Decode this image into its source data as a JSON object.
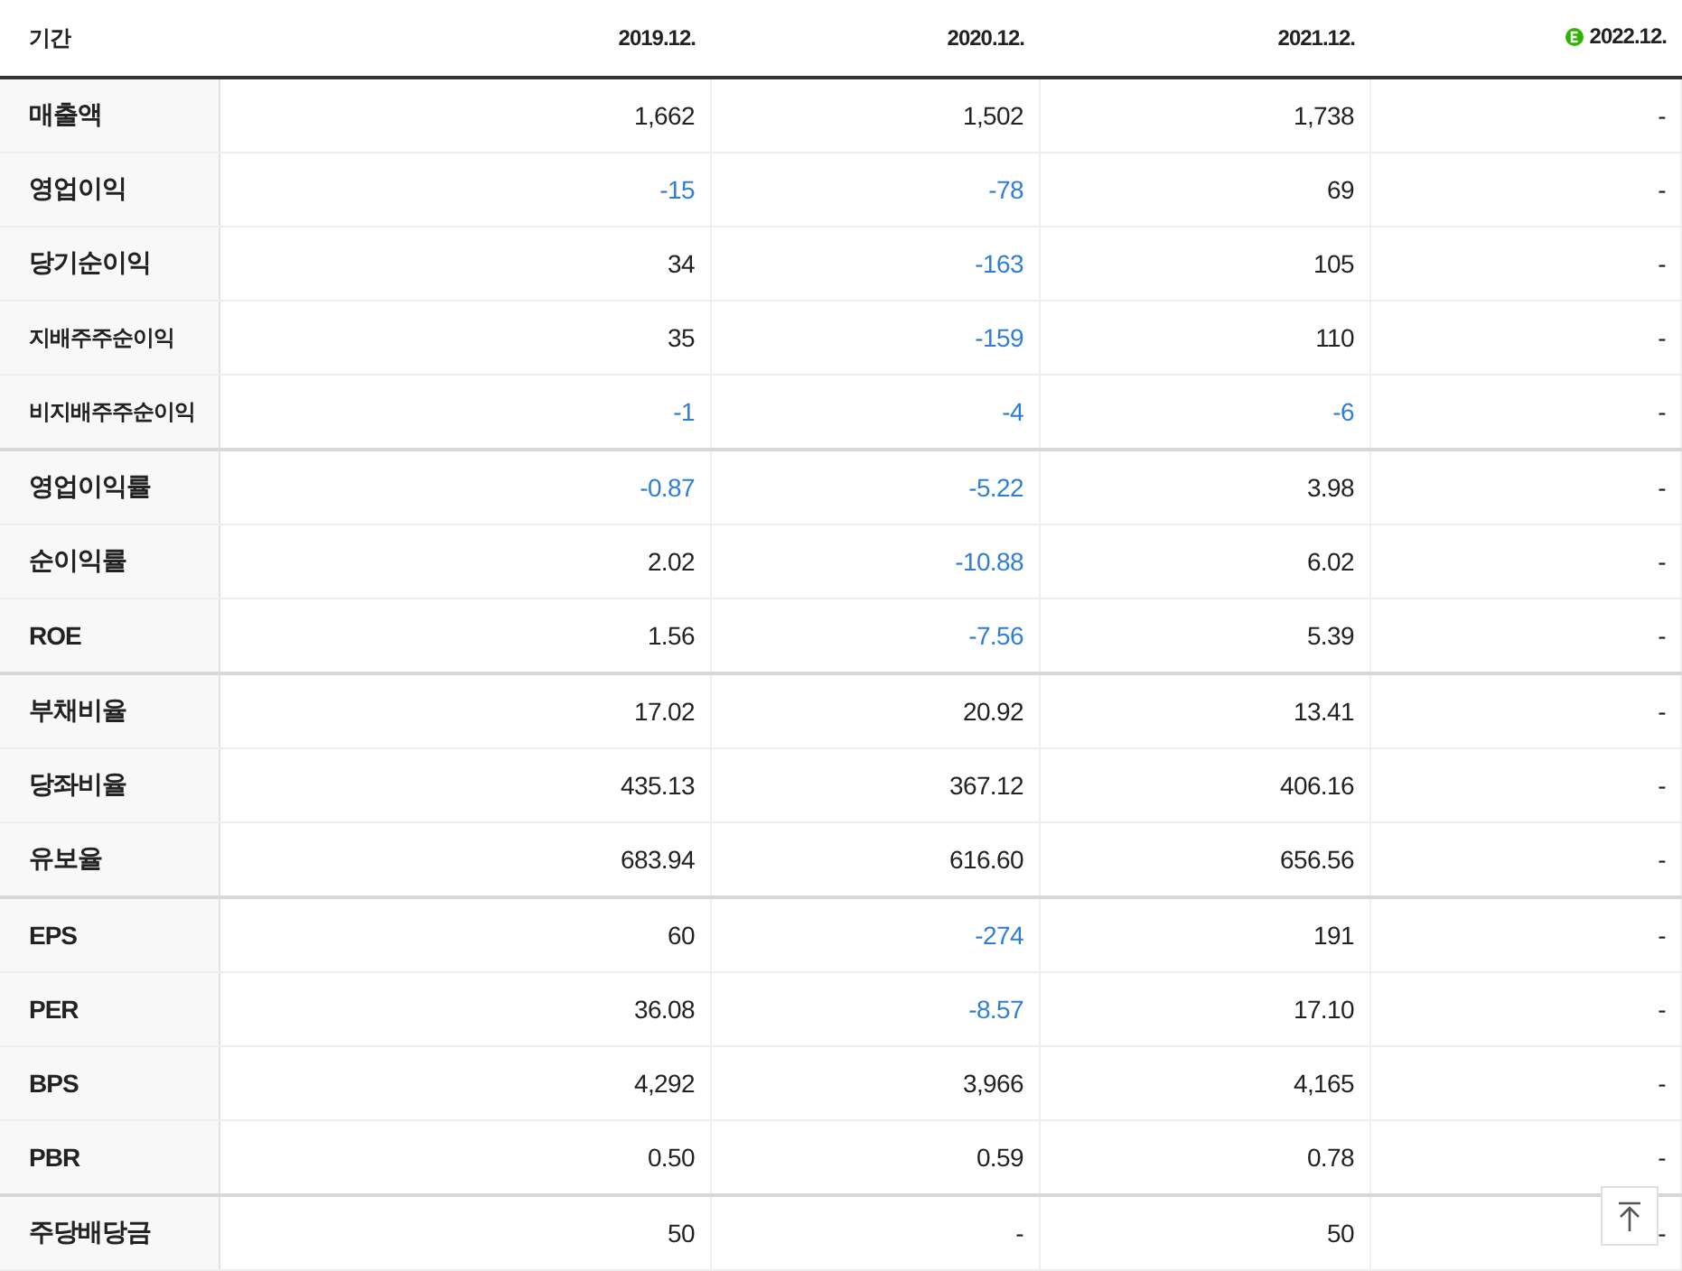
{
  "table": {
    "corner_label": "기간",
    "columns": [
      {
        "label": "2019.12.",
        "estimate": false
      },
      {
        "label": "2020.12.",
        "estimate": false
      },
      {
        "label": "2021.12.",
        "estimate": false
      },
      {
        "label": "2022.12.",
        "estimate": true
      }
    ],
    "rows": [
      {
        "label": "매출액",
        "compact": false,
        "group_start": false,
        "cells": [
          {
            "text": "1,662",
            "negative": false
          },
          {
            "text": "1,502",
            "negative": false
          },
          {
            "text": "1,738",
            "negative": false
          },
          {
            "text": "-",
            "negative": false
          }
        ]
      },
      {
        "label": "영업이익",
        "compact": false,
        "group_start": false,
        "cells": [
          {
            "text": "-15",
            "negative": true
          },
          {
            "text": "-78",
            "negative": true
          },
          {
            "text": "69",
            "negative": false
          },
          {
            "text": "-",
            "negative": false
          }
        ]
      },
      {
        "label": "당기순이익",
        "compact": false,
        "group_start": false,
        "cells": [
          {
            "text": "34",
            "negative": false
          },
          {
            "text": "-163",
            "negative": true
          },
          {
            "text": "105",
            "negative": false
          },
          {
            "text": "-",
            "negative": false
          }
        ]
      },
      {
        "label": "지배주주순이익",
        "compact": true,
        "group_start": false,
        "cells": [
          {
            "text": "35",
            "negative": false
          },
          {
            "text": "-159",
            "negative": true
          },
          {
            "text": "110",
            "negative": false
          },
          {
            "text": "-",
            "negative": false
          }
        ]
      },
      {
        "label": "비지배주주순이익",
        "compact": true,
        "group_start": false,
        "cells": [
          {
            "text": "-1",
            "negative": true
          },
          {
            "text": "-4",
            "negative": true
          },
          {
            "text": "-6",
            "negative": true
          },
          {
            "text": "-",
            "negative": false
          }
        ]
      },
      {
        "label": "영업이익률",
        "compact": false,
        "group_start": true,
        "cells": [
          {
            "text": "-0.87",
            "negative": true
          },
          {
            "text": "-5.22",
            "negative": true
          },
          {
            "text": "3.98",
            "negative": false
          },
          {
            "text": "-",
            "negative": false
          }
        ]
      },
      {
        "label": "순이익률",
        "compact": false,
        "group_start": false,
        "cells": [
          {
            "text": "2.02",
            "negative": false
          },
          {
            "text": "-10.88",
            "negative": true
          },
          {
            "text": "6.02",
            "negative": false
          },
          {
            "text": "-",
            "negative": false
          }
        ]
      },
      {
        "label": "ROE",
        "compact": false,
        "group_start": false,
        "cells": [
          {
            "text": "1.56",
            "negative": false
          },
          {
            "text": "-7.56",
            "negative": true
          },
          {
            "text": "5.39",
            "negative": false
          },
          {
            "text": "-",
            "negative": false
          }
        ]
      },
      {
        "label": "부채비율",
        "compact": false,
        "group_start": true,
        "cells": [
          {
            "text": "17.02",
            "negative": false
          },
          {
            "text": "20.92",
            "negative": false
          },
          {
            "text": "13.41",
            "negative": false
          },
          {
            "text": "-",
            "negative": false
          }
        ]
      },
      {
        "label": "당좌비율",
        "compact": false,
        "group_start": false,
        "cells": [
          {
            "text": "435.13",
            "negative": false
          },
          {
            "text": "367.12",
            "negative": false
          },
          {
            "text": "406.16",
            "negative": false
          },
          {
            "text": "-",
            "negative": false
          }
        ]
      },
      {
        "label": "유보율",
        "compact": false,
        "group_start": false,
        "cells": [
          {
            "text": "683.94",
            "negative": false
          },
          {
            "text": "616.60",
            "negative": false
          },
          {
            "text": "656.56",
            "negative": false
          },
          {
            "text": "-",
            "negative": false
          }
        ]
      },
      {
        "label": "EPS",
        "compact": false,
        "group_start": true,
        "cells": [
          {
            "text": "60",
            "negative": false
          },
          {
            "text": "-274",
            "negative": true
          },
          {
            "text": "191",
            "negative": false
          },
          {
            "text": "-",
            "negative": false
          }
        ]
      },
      {
        "label": "PER",
        "compact": false,
        "group_start": false,
        "cells": [
          {
            "text": "36.08",
            "negative": false
          },
          {
            "text": "-8.57",
            "negative": true
          },
          {
            "text": "17.10",
            "negative": false
          },
          {
            "text": "-",
            "negative": false
          }
        ]
      },
      {
        "label": "BPS",
        "compact": false,
        "group_start": false,
        "cells": [
          {
            "text": "4,292",
            "negative": false
          },
          {
            "text": "3,966",
            "negative": false
          },
          {
            "text": "4,165",
            "negative": false
          },
          {
            "text": "-",
            "negative": false
          }
        ]
      },
      {
        "label": "PBR",
        "compact": false,
        "group_start": false,
        "cells": [
          {
            "text": "0.50",
            "negative": false
          },
          {
            "text": "0.59",
            "negative": false
          },
          {
            "text": "0.78",
            "negative": false
          },
          {
            "text": "-",
            "negative": false
          }
        ]
      },
      {
        "label": "주당배당금",
        "compact": false,
        "group_start": true,
        "cells": [
          {
            "text": "50",
            "negative": false
          },
          {
            "text": "-",
            "negative": false
          },
          {
            "text": "50",
            "negative": false
          },
          {
            "text": "-",
            "negative": false
          }
        ]
      }
    ]
  }
}
